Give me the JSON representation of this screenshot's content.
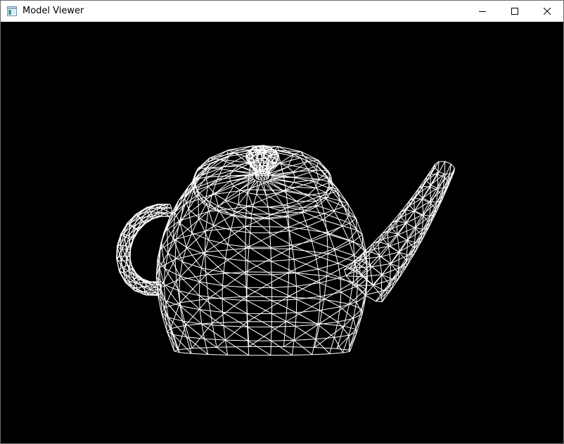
{
  "window": {
    "title": "Model Viewer",
    "app_icon": "window-app-icon",
    "controls": {
      "minimize_icon": "minimize-icon",
      "maximize_icon": "maximize-icon",
      "close_icon": "close-icon"
    }
  },
  "viewport": {
    "background_color": "#000000",
    "wireframe_color": "#ffffff",
    "render_mode": "wireframe",
    "model": "teapot"
  }
}
